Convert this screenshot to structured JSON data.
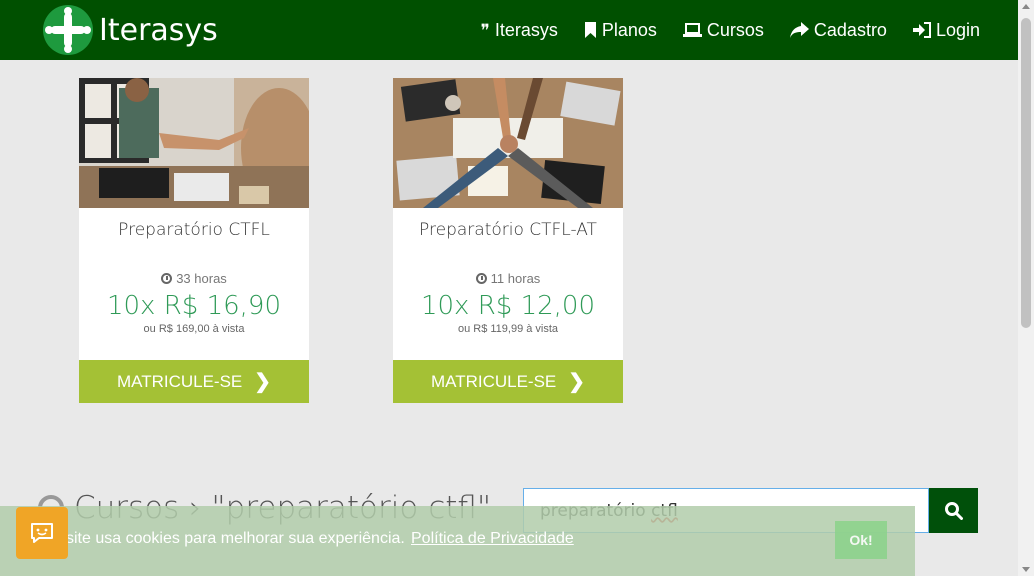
{
  "brand": {
    "name": "Iterasys"
  },
  "nav": [
    {
      "label": "Iterasys",
      "icon": "quote-icon"
    },
    {
      "label": "Planos",
      "icon": "bookmark-icon"
    },
    {
      "label": "Cursos",
      "icon": "laptop-icon"
    },
    {
      "label": "Cadastro",
      "icon": "share-arrow-icon"
    },
    {
      "label": "Login",
      "icon": "sign-in-icon"
    }
  ],
  "courses": [
    {
      "title": "Preparatório CTFL",
      "hours": "33 horas",
      "price": "10x R$ 16,90",
      "vista": "ou R$ 169,00 à vista",
      "button": "MATRICULE-SE"
    },
    {
      "title": "Preparatório CTFL-AT",
      "hours": "11 horas",
      "price": "10x R$ 12,00",
      "vista": "ou R$ 119,99 à vista",
      "button": "MATRICULE-SE"
    }
  ],
  "search": {
    "heading": "Cursos › \"preparatório ctfl\"",
    "value_prefix": "preparatório ",
    "value_misspelled": "ctfl"
  },
  "cookie": {
    "text": "site usa cookies para melhorar sua experiência.",
    "link": "Política de Privacidade",
    "ok": "Ok!"
  },
  "colors": {
    "navbar": "#005000",
    "accent_button": "#a4c135",
    "price": "#2f9a57",
    "chat": "#f0a526"
  }
}
